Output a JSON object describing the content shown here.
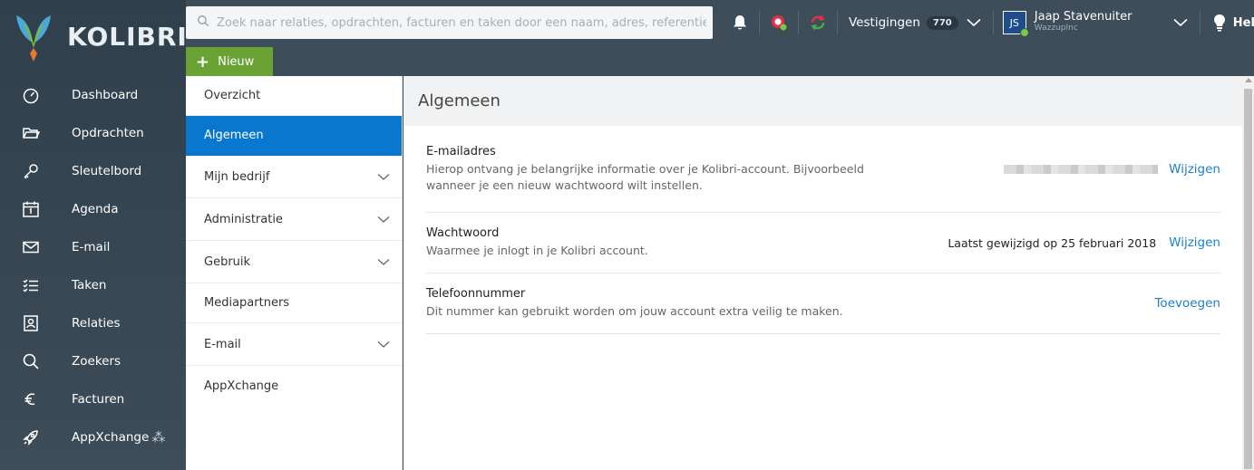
{
  "brand": {
    "name": "KOLIBRI"
  },
  "search": {
    "placeholder": "Zoek naar relaties, opdrachten, facturen en taken door een naam, adres, referentie"
  },
  "header": {
    "locations_label": "Vestigingen",
    "locations_count": "770",
    "user_initials": "JS",
    "user_name": "Jaap Stavenuiter",
    "user_company": "WazzupInc",
    "help_label": "Help"
  },
  "new_button": {
    "label": "Nieuw"
  },
  "sidebar": {
    "items": [
      {
        "label": "Dashboard",
        "icon": "dashboard-icon"
      },
      {
        "label": "Opdrachten",
        "icon": "folder-icon"
      },
      {
        "label": "Sleutelbord",
        "icon": "key-icon"
      },
      {
        "label": "Agenda",
        "icon": "calendar-icon"
      },
      {
        "label": "E-mail",
        "icon": "mail-icon"
      },
      {
        "label": "Taken",
        "icon": "tasks-icon"
      },
      {
        "label": "Relaties",
        "icon": "contacts-icon"
      },
      {
        "label": "Zoekers",
        "icon": "search-icon"
      },
      {
        "label": "Facturen",
        "icon": "euro-icon"
      },
      {
        "label": "AppXchange",
        "icon": "rocket-icon"
      }
    ]
  },
  "submenu": {
    "items": [
      {
        "label": "Overzicht"
      },
      {
        "label": "Algemeen"
      },
      {
        "label": "Mijn bedrijf"
      },
      {
        "label": "Administratie"
      },
      {
        "label": "Gebruik"
      },
      {
        "label": "Mediapartners"
      },
      {
        "label": "E-mail"
      },
      {
        "label": "AppXchange"
      }
    ]
  },
  "content": {
    "title": "Algemeen",
    "rows": [
      {
        "title": "E-mailadres",
        "desc_line1": "Hierop ontvang je belangrijke informatie over je Kolibri-account. Bijvoorbeeld",
        "desc_line2": "wanneer je een nieuw wachtwoord wilt instellen.",
        "action": "Wijzigen"
      },
      {
        "title": "Wachtwoord",
        "desc_line1": "Waarmee je inlogt in je Kolibri account.",
        "info": "Laatst gewijzigd op 25 februari 2018",
        "action": "Wijzigen"
      },
      {
        "title": "Telefoonnummer",
        "desc_line1": "Dit nummer kan gebruikt worden om jouw account extra veilig te maken.",
        "action": "Toevoegen"
      }
    ]
  },
  "colors": {
    "accent": "#0a77cf",
    "new_button": "#6aa334",
    "link": "#1d7fcc",
    "sidebar": "#3b4a56"
  }
}
